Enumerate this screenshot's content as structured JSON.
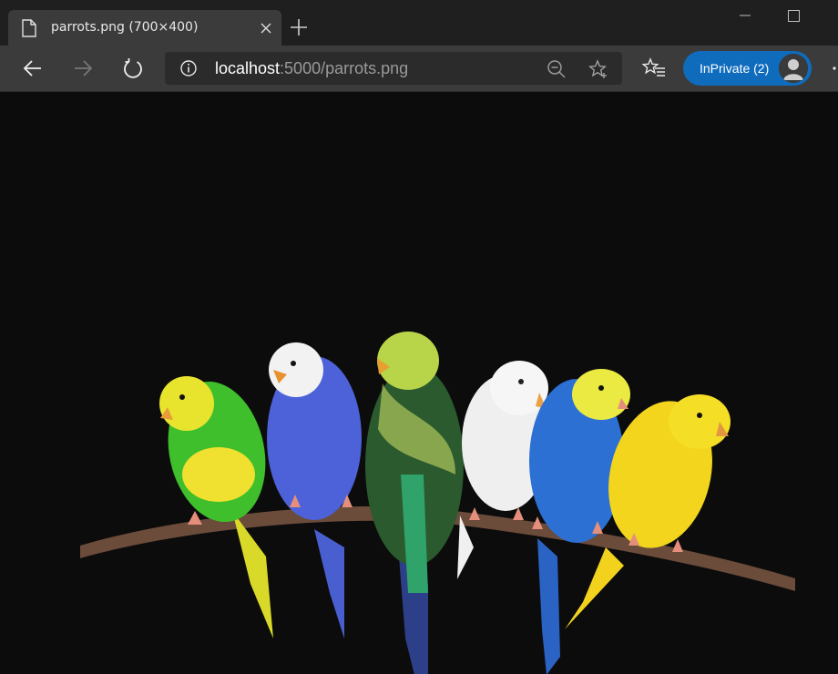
{
  "tab": {
    "title": "parrots.png (700×400)",
    "favicon_icon": "file-icon",
    "close_icon": "close-icon"
  },
  "toolbar": {
    "back_icon": "back-arrow-icon",
    "forward_icon": "forward-arrow-icon",
    "refresh_icon": "refresh-icon",
    "new_tab_icon": "plus-icon",
    "favorites_icon": "favorites-icon"
  },
  "address_bar": {
    "host": "localhost",
    "rest": ":5000/parrots.png",
    "info_icon": "info-icon",
    "zoom_icon": "zoom-out-icon",
    "favorite_icon": "star-plus-icon"
  },
  "profile": {
    "label": "InPrivate (2)",
    "avatar_icon": "profile-avatar-icon"
  },
  "content": {
    "image": "six budgerigars perched on a branch",
    "background": "#0c0c0c"
  },
  "colors": {
    "tabstrip": "#1f1f1f",
    "toolbar": "#3b3b3b",
    "accent": "#0f6cbd"
  }
}
